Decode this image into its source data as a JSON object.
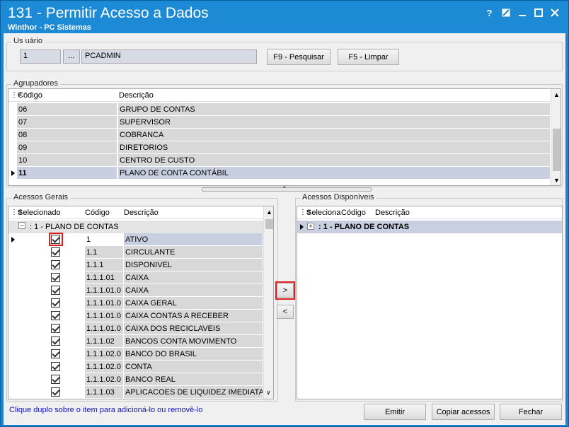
{
  "window": {
    "title": "131 - Permitir Acesso a Dados",
    "subtitle": "Winthor - PC Sistemas",
    "help_label": "?"
  },
  "usuario": {
    "group_label": "Us uário",
    "code": "1",
    "lookup_label": "...",
    "name": "PCADMIN",
    "search_button": "F9 - Pesquisar",
    "clear_button": "F5 - Limpar"
  },
  "agrupadores": {
    "group_label": "Agrupadores",
    "headers": [
      "Código",
      "Descrição"
    ],
    "rows": [
      {
        "code": "06",
        "desc": "GRUPO DE CONTAS"
      },
      {
        "code": "07",
        "desc": "SUPERVISOR"
      },
      {
        "code": "08",
        "desc": "COBRANCA"
      },
      {
        "code": "09",
        "desc": "DIRETORIOS"
      },
      {
        "code": "10",
        "desc": "CENTRO DE CUSTO"
      },
      {
        "code": "11",
        "desc": "PLANO DE CONTA CONTÁBIL"
      }
    ]
  },
  "acessos_gerais": {
    "group_label": "Acessos Gerais",
    "headers": [
      "Selecionado",
      "Código",
      "Descrição"
    ],
    "tree_node": ": 1 - PLANO DE CONTAS",
    "tree_toggle": "−",
    "rows": [
      {
        "code": "1",
        "desc": "ATIVO"
      },
      {
        "code": "1.1",
        "desc": "CIRCULANTE"
      },
      {
        "code": "1.1.1",
        "desc": "DISPONIVEL"
      },
      {
        "code": "1.1.1.01",
        "desc": "CAIXA"
      },
      {
        "code": "1.1.1.01.0",
        "desc": "CAIXA"
      },
      {
        "code": "1.1.1.01.0",
        "desc": "CAIXA GERAL"
      },
      {
        "code": "1.1.1.01.0",
        "desc": "CAIXA CONTAS A RECEBER"
      },
      {
        "code": "1.1.1.01.0",
        "desc": "CAIXA DOS RECICLAVEIS"
      },
      {
        "code": "1.1.1.02",
        "desc": "BANCOS CONTA MOVIMENTO"
      },
      {
        "code": "1.1.1.02.0",
        "desc": "BANCO DO BRASIL"
      },
      {
        "code": "1.1.1.02.0",
        "desc": "CONTA"
      },
      {
        "code": "1.1.1.02.0",
        "desc": "BANCO REAL"
      },
      {
        "code": "1.1.1.03",
        "desc": "APLICACOES DE LIQUIDEZ IMEDIATA"
      }
    ]
  },
  "acessos_disponiveis": {
    "group_label": "Acessos Disponíveis",
    "headers": [
      "Seleciona",
      "Código",
      "Descrição"
    ],
    "tree_node": ": 1 - PLANO DE CONTAS",
    "tree_toggle": "+"
  },
  "transfer": {
    "add_label": ">",
    "remove_label": "<"
  },
  "footer": {
    "hint": "Clique duplo sobre o item para adicioná-lo ou removê-lo",
    "emitir": "Emitir",
    "copiar": "Copiar acessos",
    "fechar": "Fechar"
  }
}
